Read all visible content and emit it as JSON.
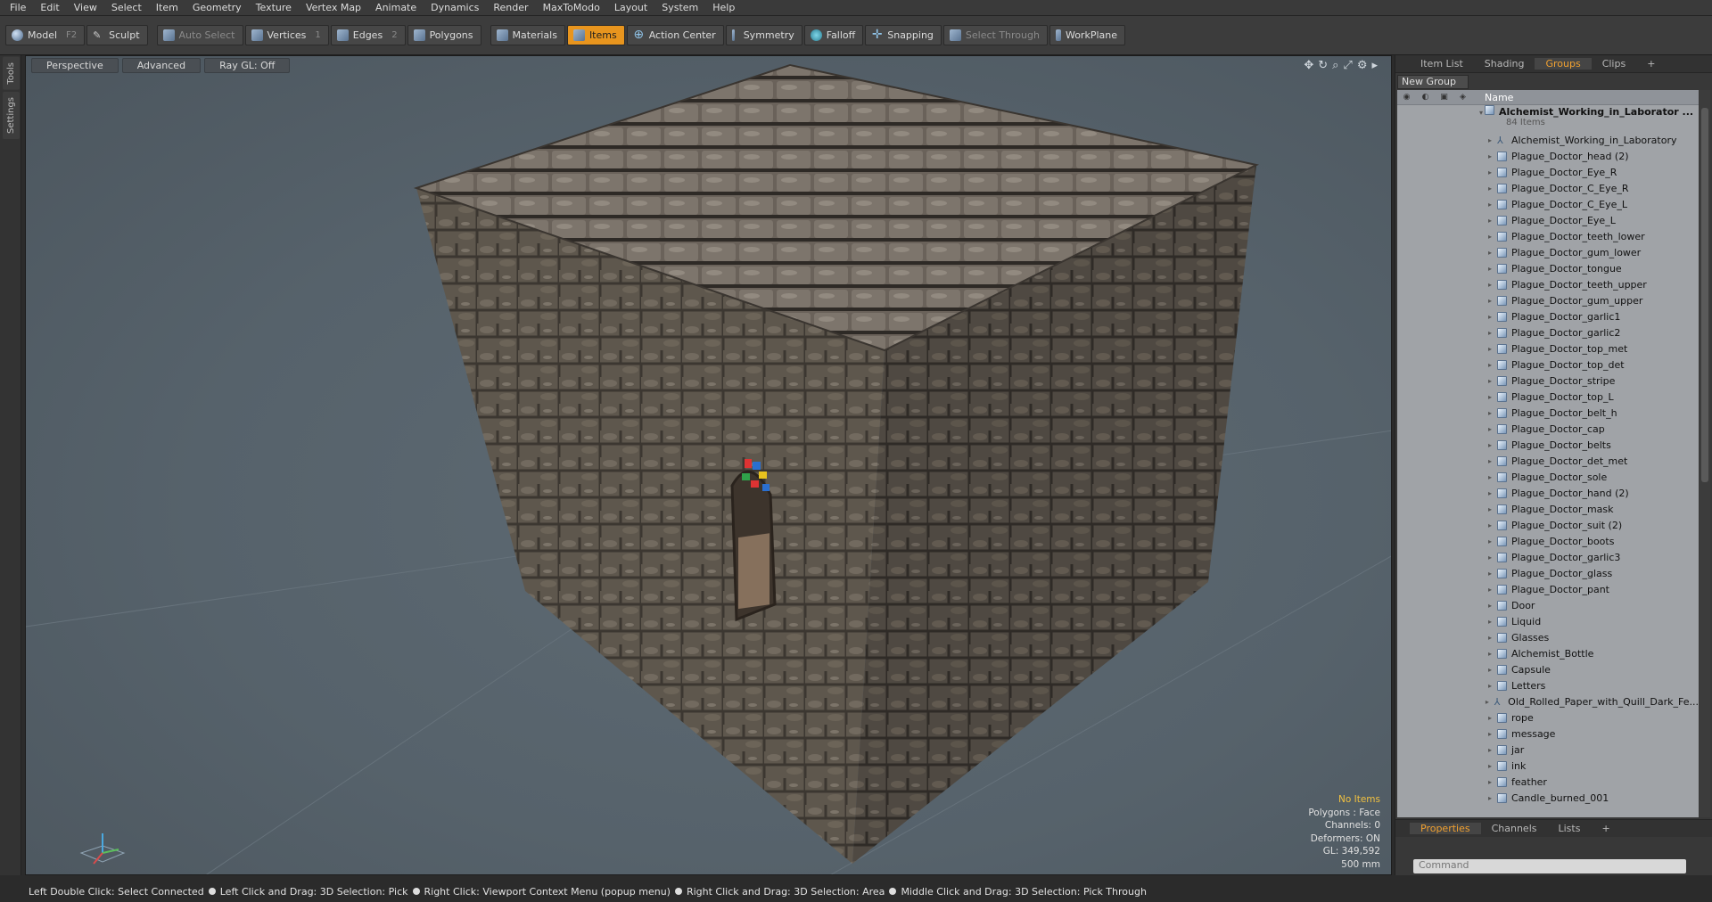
{
  "menu": [
    "File",
    "Edit",
    "View",
    "Select",
    "Item",
    "Geometry",
    "Texture",
    "Vertex Map",
    "Animate",
    "Dynamics",
    "Render",
    "MaxToModo",
    "Layout",
    "System",
    "Help"
  ],
  "toolbar": {
    "model": "Model",
    "model_key": "F2",
    "sculpt": "Sculpt",
    "auto_select": "Auto Select",
    "vertices": "Vertices",
    "vertices_key": "1",
    "edges": "Edges",
    "edges_key": "2",
    "polygons": "Polygons",
    "materials": "Materials",
    "items": "Items",
    "action_center": "Action Center",
    "symmetry": "Symmetry",
    "falloff": "Falloff",
    "snapping": "Snapping",
    "select_through": "Select Through",
    "workplane": "WorkPlane"
  },
  "left_tabs": [
    "Tools",
    "Settings"
  ],
  "viewport": {
    "perspective": "Perspective",
    "advanced": "Advanced",
    "raygl": "Ray GL: Off",
    "info": [
      "No Items",
      "Polygons : Face",
      "Channels: 0",
      "Deformers: ON",
      "GL: 349,592",
      "500 mm"
    ]
  },
  "right_tabs": [
    "Item List",
    "Shading",
    "Groups",
    "Clips",
    "+"
  ],
  "active_right_tab": "Groups",
  "new_group": "New Group",
  "list_header": "Name",
  "group": {
    "name": "Alchemist_Working_in_Laborator ...",
    "count": "84 Items"
  },
  "items": [
    {
      "name": "Alchemist_Working_in_Laboratory",
      "icon": "locator"
    },
    {
      "name": "Plague_Doctor_head (2)",
      "icon": "mesh"
    },
    {
      "name": "Plague_Doctor_Eye_R",
      "icon": "mesh"
    },
    {
      "name": "Plague_Doctor_C_Eye_R",
      "icon": "mesh"
    },
    {
      "name": "Plague_Doctor_C_Eye_L",
      "icon": "mesh"
    },
    {
      "name": "Plague_Doctor_Eye_L",
      "icon": "mesh"
    },
    {
      "name": "Plague_Doctor_teeth_lower",
      "icon": "mesh"
    },
    {
      "name": "Plague_Doctor_gum_lower",
      "icon": "mesh"
    },
    {
      "name": "Plague_Doctor_tongue",
      "icon": "mesh"
    },
    {
      "name": "Plague_Doctor_teeth_upper",
      "icon": "mesh"
    },
    {
      "name": "Plague_Doctor_gum_upper",
      "icon": "mesh"
    },
    {
      "name": "Plague_Doctor_garlic1",
      "icon": "mesh"
    },
    {
      "name": "Plague_Doctor_garlic2",
      "icon": "mesh"
    },
    {
      "name": "Plague_Doctor_top_met",
      "icon": "mesh"
    },
    {
      "name": "Plague_Doctor_top_det",
      "icon": "mesh"
    },
    {
      "name": "Plague_Doctor_stripe",
      "icon": "mesh"
    },
    {
      "name": "Plague_Doctor_top_L",
      "icon": "mesh"
    },
    {
      "name": "Plague_Doctor_belt_h",
      "icon": "mesh"
    },
    {
      "name": "Plague_Doctor_cap",
      "icon": "mesh"
    },
    {
      "name": "Plague_Doctor_belts",
      "icon": "mesh"
    },
    {
      "name": "Plague_Doctor_det_met",
      "icon": "mesh"
    },
    {
      "name": "Plague_Doctor_sole",
      "icon": "mesh"
    },
    {
      "name": "Plague_Doctor_hand (2)",
      "icon": "mesh"
    },
    {
      "name": "Plague_Doctor_mask",
      "icon": "mesh"
    },
    {
      "name": "Plague_Doctor_suit (2)",
      "icon": "mesh"
    },
    {
      "name": "Plague_Doctor_boots",
      "icon": "mesh"
    },
    {
      "name": "Plague_Doctor_garlic3",
      "icon": "mesh"
    },
    {
      "name": "Plague_Doctor_glass",
      "icon": "mesh"
    },
    {
      "name": "Plague_Doctor_pant",
      "icon": "mesh"
    },
    {
      "name": "Door",
      "icon": "mesh"
    },
    {
      "name": "Liquid",
      "icon": "mesh"
    },
    {
      "name": "Glasses",
      "icon": "mesh"
    },
    {
      "name": "Alchemist_Bottle",
      "icon": "mesh"
    },
    {
      "name": "Capsule",
      "icon": "mesh"
    },
    {
      "name": "Letters",
      "icon": "mesh"
    },
    {
      "name": "Old_Rolled_Paper_with_Quill_Dark_Fe...",
      "icon": "locator"
    },
    {
      "name": "rope",
      "icon": "mesh"
    },
    {
      "name": "message",
      "icon": "mesh"
    },
    {
      "name": "jar",
      "icon": "mesh"
    },
    {
      "name": "ink",
      "icon": "mesh"
    },
    {
      "name": "feather",
      "icon": "mesh"
    },
    {
      "name": "Candle_burned_001",
      "icon": "mesh"
    }
  ],
  "bottom_tabs": [
    "Properties",
    "Channels",
    "Lists",
    "+"
  ],
  "command_placeholder": "Command",
  "status": [
    "Left Double Click: Select Connected",
    "Left Click and Drag: 3D Selection: Pick",
    "Right Click: Viewport Context Menu (popup menu)",
    "Right Click and Drag: 3D Selection: Area",
    "Middle Click and Drag: 3D Selection: Pick Through"
  ],
  "colors": {
    "accent": "#e8951e",
    "list_bg": "#a0a3a7",
    "viewport_bg": "#56626b"
  }
}
